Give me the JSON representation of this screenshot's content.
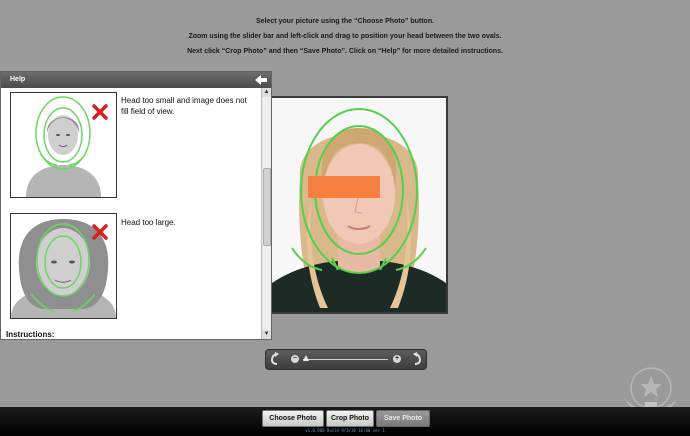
{
  "instructions": [
    "Select your picture using the “Choose Photo” button.",
    "Zoom using the slider bar and left-click and drag to position your head between the two ovals.",
    "Next click “Crop Photo” and then “Save Photo”.  Click on “Help” for more detailed instructions."
  ],
  "help": {
    "title": "Help",
    "examples": [
      {
        "text": "Head too small and image does not fill field of view.",
        "icon": "red-x-icon"
      },
      {
        "text": "Head too large.",
        "icon": "red-x-icon"
      }
    ],
    "instructions_heading": "Instructions:"
  },
  "toolbar": {
    "choose_photo": "Choose Photo",
    "crop_photo": "Crop Photo",
    "save_photo": "Save Photo"
  },
  "version": "v1.0.900 Build 9/3/10 16:00 ver 1",
  "colors": {
    "guide_oval": "#55d04a",
    "redact_bar": "#f47f3e",
    "reject_mark": "#d81e1e",
    "background": "#9a9a9a"
  }
}
